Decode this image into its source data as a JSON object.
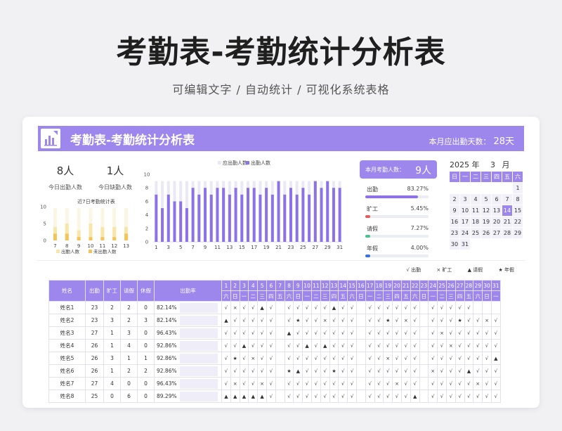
{
  "hero": {
    "title": "考勤表-考勤统计分析表",
    "subtitle": "可编辑文字 / 自动统计 / 可视化系统表格"
  },
  "banner": {
    "title": "考勤表-考勤统计分析表",
    "days_label": "本月应出勤天数：",
    "days_value": "28天"
  },
  "stats": {
    "present_value": "8人",
    "present_label": "今日出勤人数",
    "absent_value": "1人",
    "absent_label": "今日缺勤人数"
  },
  "colors": {
    "accent": "#9d86ec",
    "bar_expected": "#ebe8f6",
    "bar_actual": "#8c72e6",
    "mini_present": "#f8e6a8",
    "mini_absent": "#f3c45a",
    "progress_attend": "#8c72e6",
    "progress_absent": "#e45c5c",
    "progress_leave": "#4cc28b",
    "progress_annual": "#3d6fe0"
  },
  "chart_data": [
    {
      "type": "bar",
      "title": "近7日考勤统计表",
      "categories": [
        "7",
        "8",
        "9",
        "10",
        "11",
        "12",
        "13"
      ],
      "ylim": [
        0,
        10
      ],
      "yticks": [
        "0",
        "5",
        "10"
      ],
      "series": [
        {
          "name": "出勤人数",
          "values": [
            4,
            5,
            3,
            5,
            4,
            4,
            4
          ]
        },
        {
          "name": "未出勤人数",
          "values": [
            2,
            2,
            1,
            1,
            1,
            1,
            2
          ]
        }
      ]
    },
    {
      "type": "bar",
      "legend": "top",
      "ylim": [
        0,
        10
      ],
      "yticks": [
        "0",
        "2",
        "4",
        "6",
        "8",
        "10"
      ],
      "x": [
        "1",
        "2",
        "3",
        "4",
        "5",
        "6",
        "7",
        "8",
        "9",
        "10",
        "11",
        "12",
        "13",
        "14",
        "15",
        "16",
        "17",
        "18",
        "19",
        "20",
        "21",
        "22",
        "23",
        "24",
        "25",
        "26",
        "27",
        "28",
        "29",
        "30",
        "31"
      ],
      "xticks": [
        "1",
        "3",
        "5",
        "7",
        "9",
        "11",
        "13",
        "15",
        "17",
        "19",
        "21",
        "23",
        "25",
        "27",
        "29",
        "31"
      ],
      "series": [
        {
          "name": "应出勤人数",
          "values": [
            9,
            9,
            9,
            9,
            9,
            9,
            9,
            9,
            9,
            9,
            9,
            9,
            9,
            9,
            9,
            9,
            9,
            9,
            9,
            9,
            9,
            9,
            9,
            9,
            9,
            9,
            9,
            9,
            9,
            9,
            9
          ]
        },
        {
          "name": "出勤人数",
          "values": [
            7,
            5,
            7,
            6,
            6,
            5,
            8,
            7,
            8,
            7,
            8,
            8,
            7,
            8,
            7,
            8,
            8,
            7,
            8,
            7,
            9,
            7,
            8,
            7,
            8,
            7,
            9,
            8,
            9,
            8,
            8
          ]
        }
      ]
    }
  ],
  "month_summary": {
    "label": "本月考勤人数：",
    "value": "9人",
    "items": [
      {
        "name": "出勤",
        "pct": "83.27%",
        "value": 0.8327
      },
      {
        "name": "旷工",
        "pct": "5.45%",
        "value": 0.0545
      },
      {
        "name": "请假",
        "pct": "7.27%",
        "value": 0.0727
      },
      {
        "name": "年假",
        "pct": "4.00%",
        "value": 0.04
      }
    ]
  },
  "calendar": {
    "year": "2025",
    "year_unit": "年",
    "month": "3",
    "month_unit": "月",
    "weekdays": [
      "日",
      "一",
      "二",
      "三",
      "四",
      "五",
      "六"
    ],
    "days": [
      "",
      "",
      "",
      "",
      "",
      "",
      "1",
      "2",
      "3",
      "4",
      "5",
      "6",
      "7",
      "8",
      "9",
      "10",
      "11",
      "12",
      "13",
      "14",
      "15",
      "16",
      "17",
      "18",
      "19",
      "20",
      "21",
      "22",
      "23",
      "24",
      "25",
      "26",
      "27",
      "28",
      "29",
      "30",
      "31"
    ],
    "today": "14"
  },
  "legend": {
    "present": "√ 出勤",
    "absent": "× 旷工",
    "leave": "▲ 请假",
    "annual": "★ 年假"
  },
  "table": {
    "headers": [
      "姓名",
      "出勤",
      "旷工",
      "请假",
      "休假",
      "出勤率"
    ],
    "day_numbers": [
      "1",
      "2",
      "3",
      "4",
      "5",
      "6",
      "7",
      "8",
      "9",
      "10",
      "11",
      "12",
      "13",
      "14",
      "15",
      "16",
      "17",
      "18",
      "19",
      "20",
      "21",
      "22",
      "23",
      "24",
      "25",
      "26",
      "27",
      "28",
      "29",
      "30",
      "31"
    ],
    "day_weekdays": [
      "六",
      "日",
      "一",
      "二",
      "三",
      "四",
      "五",
      "六",
      "日",
      "一",
      "二",
      "三",
      "四",
      "五",
      "六",
      "日",
      "一",
      "二",
      "三",
      "四",
      "五",
      "六",
      "日",
      "一",
      "二",
      "三",
      "四",
      "五",
      "六",
      "日",
      "一"
    ],
    "rows": [
      {
        "name": "姓名1",
        "attend": "23",
        "absent": "2",
        "leave": "2",
        "rest": "0",
        "rate": "82.14%",
        "marks": [
          "√",
          "×",
          "√",
          "√",
          "▲",
          "√",
          "",
          "√",
          "√",
          "√",
          "√",
          "√",
          "▲",
          "√",
          "√",
          "",
          "√",
          "√",
          "√",
          "√",
          "√",
          "√",
          "",
          "√",
          "√",
          "√",
          "√",
          "√",
          "",
          "",
          ""
        ]
      },
      {
        "name": "姓名2",
        "attend": "23",
        "absent": "3",
        "leave": "2",
        "rest": "3",
        "rate": "82.14%",
        "marks": [
          "▲",
          "√",
          "√",
          "√",
          "√",
          "√",
          "",
          "√",
          "★",
          "√",
          "√",
          "×",
          "√",
          "√",
          "√",
          "",
          "√",
          "√",
          "★",
          "√",
          "×",
          "√",
          "",
          "√",
          "√",
          "√",
          "★",
          "√",
          "√",
          "×",
          "√"
        ]
      },
      {
        "name": "姓名3",
        "attend": "27",
        "absent": "1",
        "leave": "3",
        "rest": "0",
        "rate": "96.43%",
        "marks": [
          "√",
          "√",
          "√",
          "√",
          "√",
          "√",
          "",
          "▲",
          "√",
          "√",
          "√",
          "√",
          "√",
          "√",
          "√",
          "",
          "√",
          "√",
          "√",
          "√",
          "√",
          "√",
          "",
          "√",
          "×",
          "√",
          "√",
          "√",
          "√",
          "√",
          "√"
        ]
      },
      {
        "name": "姓名4",
        "attend": "26",
        "absent": "1",
        "leave": "4",
        "rest": "0",
        "rate": "92.86%",
        "marks": [
          "√",
          "√",
          "▲",
          "√",
          "√",
          "√",
          "",
          "√",
          "√",
          "▲",
          "√",
          "▲",
          "√",
          "√",
          "√",
          "",
          "√",
          "√",
          "√",
          "√",
          "√",
          "√",
          "",
          "√",
          "√",
          "×",
          "√",
          "√",
          "√",
          "√",
          "√"
        ]
      },
      {
        "name": "姓名5",
        "attend": "26",
        "absent": "3",
        "leave": "1",
        "rest": "1",
        "rate": "92.86%",
        "marks": [
          "√",
          "★",
          "√",
          "×",
          "√",
          "√",
          "",
          "√",
          "√",
          "√",
          "√",
          "√",
          "√",
          "√",
          "√",
          "",
          "√",
          "√",
          "×",
          "√",
          "√",
          "√",
          "",
          "√",
          "√",
          "√",
          "√",
          "√",
          "√",
          "√",
          "▲"
        ]
      },
      {
        "name": "姓名6",
        "attend": "26",
        "absent": "1",
        "leave": "2",
        "rest": "2",
        "rate": "92.86%",
        "marks": [
          "√",
          "√",
          "√",
          "√",
          "√",
          "√",
          "",
          "★",
          "▲",
          "√",
          "√",
          "√",
          "★",
          "√",
          "√",
          "",
          "√",
          "√",
          "√",
          "√",
          "√",
          "√",
          "",
          "×",
          "√",
          "√",
          "√",
          "▲",
          "√",
          "√",
          "√"
        ]
      },
      {
        "name": "姓名7",
        "attend": "27",
        "absent": "4",
        "leave": "0",
        "rest": "0",
        "rate": "96.43%",
        "marks": [
          "√",
          "×",
          "√",
          "√",
          "×",
          "√",
          "",
          "√",
          "√",
          "√",
          "√",
          "√",
          "√",
          "√",
          "√",
          "",
          "√",
          "√",
          "√",
          "×",
          "√",
          "√",
          "",
          "√",
          "√",
          "√",
          "√",
          "√",
          "×",
          "√",
          "√"
        ]
      },
      {
        "name": "姓名8",
        "attend": "25",
        "absent": "0",
        "leave": "6",
        "rest": "0",
        "rate": "89.29%",
        "marks": [
          "▲",
          "▲",
          "▲",
          "▲",
          "▲",
          "√",
          "",
          "√",
          "√",
          "√",
          "√",
          "√",
          "√",
          "√",
          "√",
          "",
          "√",
          "√",
          "√",
          "√",
          "√",
          "▲",
          "",
          "√",
          "√",
          "√",
          "√",
          "√",
          "√",
          "√",
          "√"
        ]
      }
    ]
  }
}
